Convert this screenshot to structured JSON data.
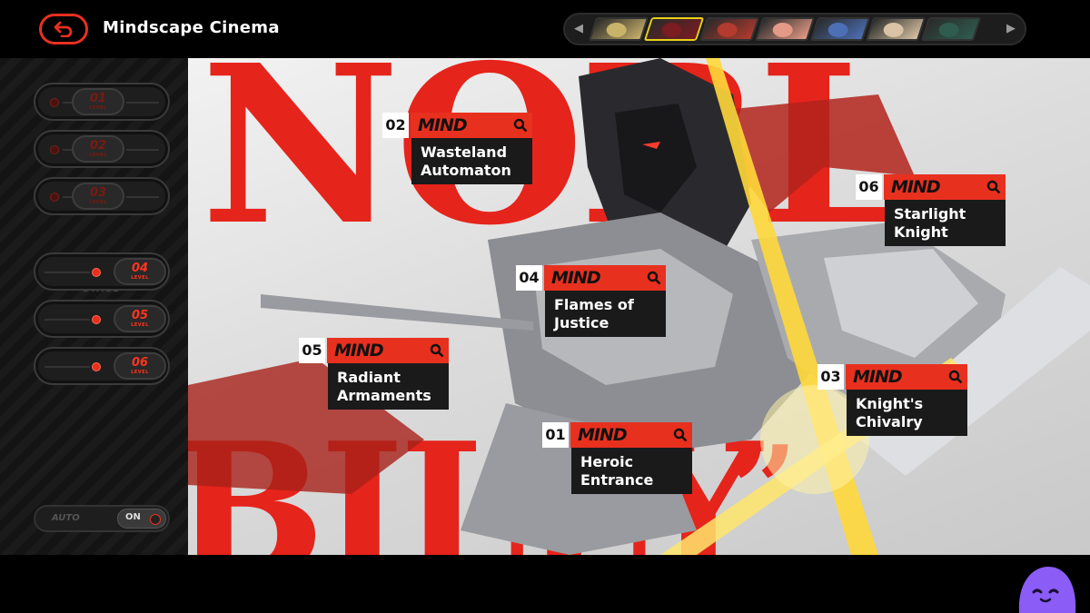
{
  "header": {
    "title": "Mindscape Cinema"
  },
  "characters": [
    {
      "name": "character-1",
      "color": "#c9b26a"
    },
    {
      "name": "character-2",
      "color": "#7a1c22",
      "selected": true
    },
    {
      "name": "character-3",
      "color": "#b33a2e"
    },
    {
      "name": "character-4",
      "color": "#e39a86"
    },
    {
      "name": "character-5",
      "color": "#4c6fb5"
    },
    {
      "name": "character-6",
      "color": "#d9c3a4"
    },
    {
      "name": "character-7",
      "color": "#2f5c4e"
    }
  ],
  "sidebar": {
    "levels": [
      {
        "num": "01",
        "sub": "LEVEL",
        "state": "dim"
      },
      {
        "num": "02",
        "sub": "LEVEL",
        "state": "dim"
      },
      {
        "num": "03",
        "sub": "LEVEL",
        "state": "dim"
      },
      {
        "num": "04",
        "sub": "LEVEL",
        "state": "lit"
      },
      {
        "num": "05",
        "sub": "LEVEL",
        "state": "lit"
      },
      {
        "num": "06",
        "sub": "LEVEL",
        "state": "lit"
      }
    ],
    "stage_label": "STAGE",
    "auto_label": "AUTO",
    "auto_state": "ON"
  },
  "background_text": {
    "top": "NOBL",
    "bottom": "BILLY",
    "quote": "”"
  },
  "mindscapes": [
    {
      "num": "02",
      "tag": "MIND",
      "title": "Wasteland\nAutomaton"
    },
    {
      "num": "06",
      "tag": "MIND",
      "title": "Starlight\nKnight"
    },
    {
      "num": "04",
      "tag": "MIND",
      "title": "Flames of\nJustice"
    },
    {
      "num": "05",
      "tag": "MIND",
      "title": "Radiant\nArmaments"
    },
    {
      "num": "03",
      "tag": "MIND",
      "title": "Knight's\nChivalry"
    },
    {
      "num": "01",
      "tag": "MIND",
      "title": "Heroic\nEntrance"
    }
  ],
  "colors": {
    "accent": "#e8301f",
    "selected_border": "#e7d11b",
    "mascot": "#8b5cf6"
  }
}
